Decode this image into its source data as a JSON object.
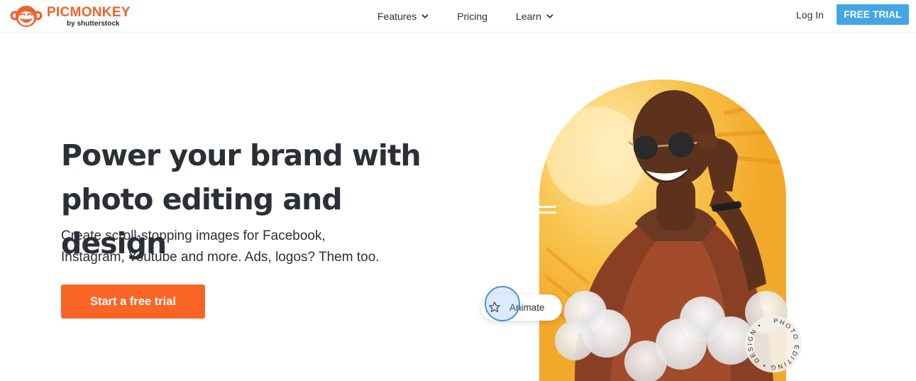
{
  "header": {
    "logo": {
      "word": "PICMONKEY",
      "sub": "by shutterstock"
    },
    "nav": [
      {
        "label": "Features",
        "has_dropdown": true
      },
      {
        "label": "Pricing",
        "has_dropdown": false
      },
      {
        "label": "Learn",
        "has_dropdown": true
      }
    ],
    "login_label": "Log In",
    "free_trial_label": "FREE TRIAL"
  },
  "hero": {
    "title_line1": "Power your brand with",
    "title_line2": "photo editing and design",
    "subtitle_line1": "Create scroll-stopping images for Facebook,",
    "subtitle_line2": "Instagram, Youtube and more. Ads, logos? Them too.",
    "cta_label": "Start a free trial"
  },
  "illustration": {
    "animate_label": "Animate",
    "badge_text": "PHOTO EDITING • DESIGN •",
    "icons": [
      "star-icon"
    ]
  },
  "colors": {
    "brand_orange": "#f0622d",
    "cta_orange": "#fa6424",
    "trial_blue": "#44a5e6",
    "text_dark": "#2b2f36",
    "arch_yellow": "#f6b532"
  }
}
